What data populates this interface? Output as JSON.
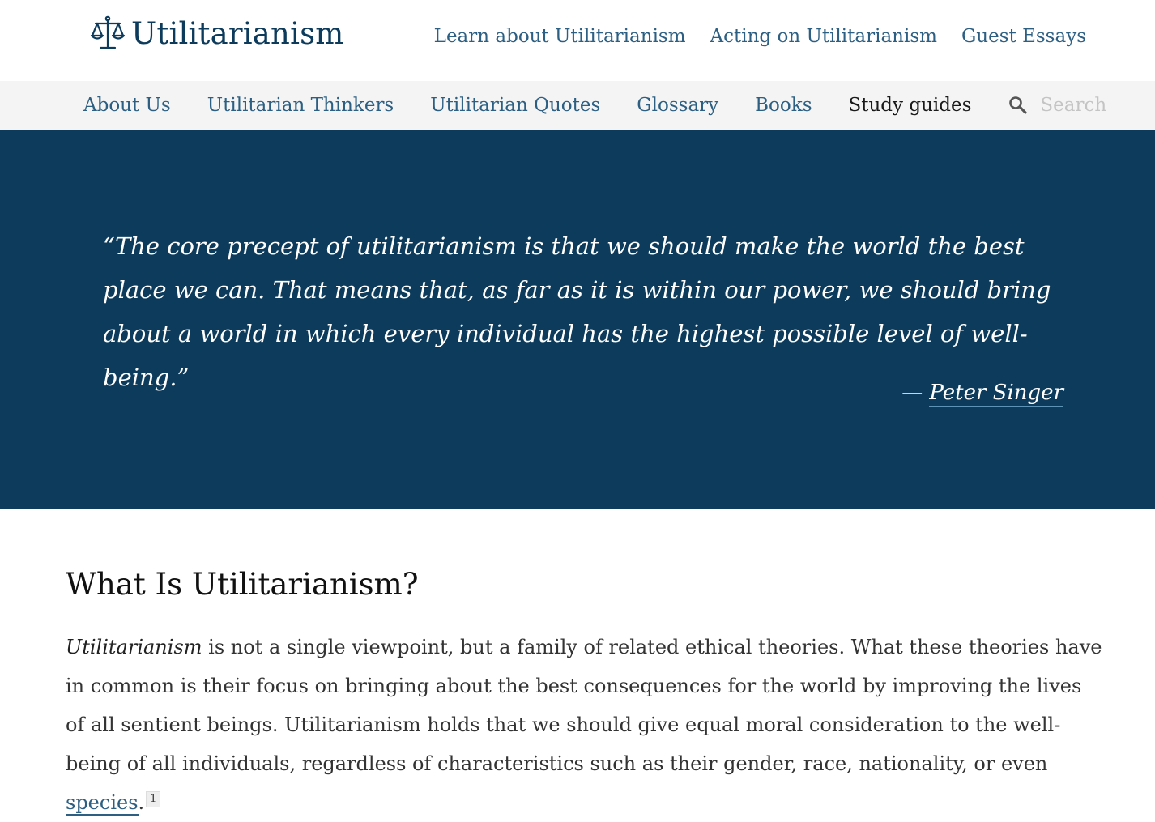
{
  "site": {
    "logo_text": "Utilitarianism",
    "logo_icon": "scales-of-justice-icon",
    "brand_color": "#0c3b5c",
    "link_color": "#2c5f82"
  },
  "top_nav": [
    {
      "label": "Learn about Utilitarianism"
    },
    {
      "label": "Acting on Utilitarianism"
    },
    {
      "label": "Guest Essays"
    }
  ],
  "sub_nav": [
    {
      "label": "About Us"
    },
    {
      "label": "Utilitarian Thinkers"
    },
    {
      "label": "Utilitarian Quotes"
    },
    {
      "label": "Glossary"
    },
    {
      "label": "Books"
    },
    {
      "label": "Study guides"
    }
  ],
  "search": {
    "placeholder": "Search",
    "icon": "search-icon"
  },
  "hero": {
    "quote": "“The core precept of utilitarianism is that we should make the world the best place we can. That means that, as far as it is within our power, we should bring about a world in which every individual has the highest possible level of well-being.”",
    "attribution_dash": "— ",
    "attribution_name": "Peter Singer"
  },
  "article": {
    "heading": "What Is Utilitarianism?",
    "para_em": "Utilitarianism",
    "para_text": " is not a single viewpoint, but a family of related ethical theories. What these theories have in common is their focus on bringing about the best consequences for the world by improving the lives of all sentient beings. Utilitarianism holds that we should give equal moral consideration to the well-being of all individuals, regardless of characteristics such as their gender, race, nationality, or even ",
    "para_link": "species",
    "para_end": ".",
    "footnote": "1"
  }
}
